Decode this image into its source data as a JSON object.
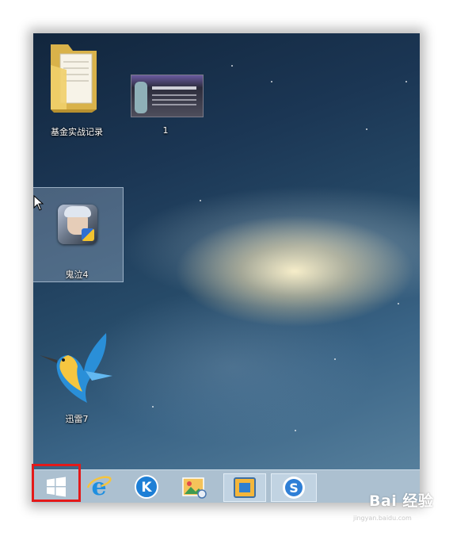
{
  "desktop": {
    "icons": [
      {
        "label": "基金实战记录",
        "kind": "folder-icon"
      },
      {
        "label": "1",
        "kind": "website-thumbnail"
      },
      {
        "label": "鬼泣4",
        "kind": "game-icon",
        "selected": true
      },
      {
        "label": "迅雷7",
        "kind": "hummingbird-icon"
      }
    ]
  },
  "taskbar": {
    "items": [
      {
        "name": "start-button",
        "icon": "windows-logo-icon",
        "highlighted": true
      },
      {
        "name": "internet-explorer",
        "icon": "ie-icon"
      },
      {
        "name": "kugou",
        "icon": "k-circle-icon"
      },
      {
        "name": "photo-app",
        "icon": "image-icon"
      },
      {
        "name": "file-explorer",
        "icon": "folder-window-icon",
        "active": true
      },
      {
        "name": "sogou",
        "icon": "s-circle-icon",
        "active": true
      }
    ]
  },
  "watermark": {
    "main": "Bai 经验",
    "sub": "jingyan.baidu.com"
  },
  "colors": {
    "highlight": "#e31a1a",
    "taskbar": "#8ca8be"
  }
}
